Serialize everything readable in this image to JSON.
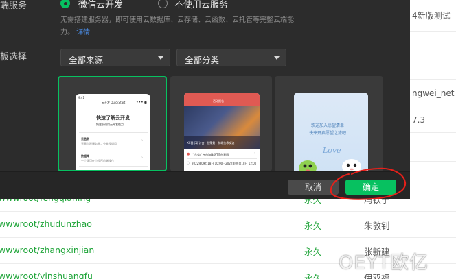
{
  "dialog": {
    "cloud_label": "云端服务",
    "radio_wechat": "微信云开发",
    "radio_none": "不使用云服务",
    "description_line1": "无需搭建服务器，即可使用云数据库、云存储、云函数、云托管等完整云端能",
    "description_line2": "力。",
    "description_link": "详情",
    "template_label": "模板选择",
    "source_select": "全部来源",
    "category_select": "全部分类",
    "cancel_label": "取消",
    "ok_label": "确定"
  },
  "templates": {
    "card1": {
      "time": "9:41",
      "topbar": "云开发 QuickStart",
      "heading": "快速了解云开发",
      "subheading": "免鉴权调用云开发能力",
      "rows": [
        "云函数",
        "数据库"
      ],
      "row_descs": [
        "无需自建服务器，免鉴权调用",
        "一个既可在小程序前端操作"
      ]
    },
    "card2": {
      "header": "活动报名",
      "banner_text": "XX音乐研讨会 · 总策划：前端技术交流",
      "location": "广东省广州市海珠区TIT创意园",
      "date": "2022年09月18日 10:00 - 2022年09月18日 12:00"
    },
    "card3": {
      "line1": "欢迎加入愿望清单！",
      "line2": "快来开启愿望之旅吧！",
      "script": "Love"
    }
  },
  "background": {
    "right_texts": [
      "4新版测试",
      "ngwei_net",
      "7.3"
    ],
    "rows": [
      {
        "path": "wwwroot/fengqianing",
        "duration": "永久",
        "name": "冯钦宁"
      },
      {
        "path": "wwwroot/zhudunzhao",
        "duration": "永久",
        "name": "朱敦钊"
      },
      {
        "path": "wwwroot/zhangxinjian",
        "duration": "永久",
        "name": "张新建"
      },
      {
        "path": "wwwroot/yinshuangfu",
        "duration": "永久",
        "name": "伊双福"
      }
    ]
  },
  "watermark": "OEYT欧亿",
  "colors": {
    "accent": "#07c160",
    "dialog_bg": "#2c2c2c",
    "link": "#4b8de6",
    "annotation": "#e8201a",
    "table_text": "#20a53a"
  }
}
